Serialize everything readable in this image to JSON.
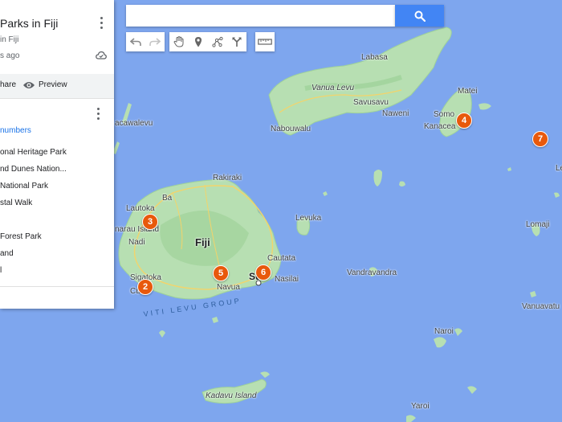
{
  "panel": {
    "title": "Parks in Fiji",
    "subtitle": "in Fiji",
    "saved": "s ago",
    "share": "hare",
    "preview": "Preview",
    "layer_name": "numbers",
    "items": [
      "onal Heritage Park",
      "nd Dunes Nation...",
      "National Park",
      "stal Walk",
      "",
      "Forest Park",
      "and",
      "l"
    ]
  },
  "search": {
    "value": "",
    "placeholder": ""
  },
  "toolbar": {
    "icons": [
      "undo-icon",
      "redo-icon",
      "hand-icon",
      "marker-icon",
      "line-icon",
      "directions-icon",
      "ruler-icon"
    ]
  },
  "map": {
    "places": {
      "labasa": "Labasa",
      "vanua_levu": "Vanua Levu",
      "savusavu": "Savusavu",
      "naweni": "Naweni",
      "nabouwalu": "Nabouwalu",
      "matei": "Matei",
      "somosomo": "Somo",
      "kanacea": "Kanacea",
      "yacata": "acawalevu",
      "rakiraki": "Rakiraki",
      "ba": "Ba",
      "lautoka": "Lautoka",
      "denarau": "narau Island",
      "nadi": "Nadi",
      "fiji": "Fiji",
      "levuka": "Levuka",
      "cautata": "Cautata",
      "nasilai": "Nasilai",
      "suva": "Su",
      "navua": "Navua",
      "sigatoka": "Sigatoka",
      "cuvu": "Cu",
      "vandravandra": "Vandravandra",
      "lomaji": "Lomaji",
      "vanuavatu": "Vanuavatu",
      "naroi": "Naroi",
      "kadavu": "Kadavu Island",
      "yaroi": "Yaroi",
      "le": "Le",
      "viti_levu_group": "VITI LEVU GROUP"
    },
    "markers": [
      "2",
      "3",
      "4",
      "5",
      "6",
      "7"
    ]
  },
  "colors": {
    "water": "#7ea6ee",
    "land": "#b7dfb2",
    "land_dark": "#9fd29a",
    "road": "#f3d46b",
    "marker": "#e8590c",
    "link": "#1a73e8",
    "search_button": "#4285f4"
  }
}
